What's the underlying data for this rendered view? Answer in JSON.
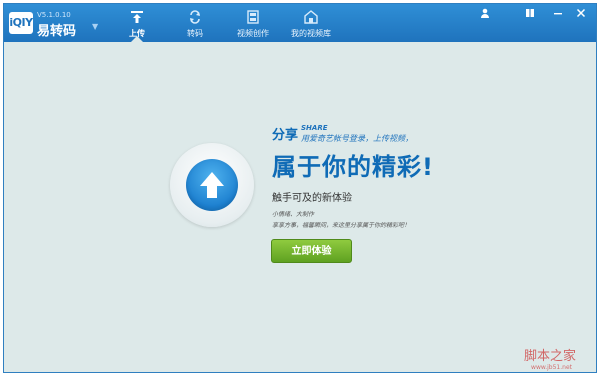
{
  "app": {
    "logo_text": "iQIY",
    "version": "V5.1.0.10",
    "name": "易转码"
  },
  "tabs": [
    {
      "label": "上传",
      "icon": "upload-tab-icon",
      "active": true
    },
    {
      "label": "转码",
      "icon": "convert-icon",
      "active": false
    },
    {
      "label": "视频创作",
      "icon": "film-icon",
      "active": false
    },
    {
      "label": "我的视频库",
      "icon": "home-icon",
      "active": false
    }
  ],
  "window_controls": {
    "user": "user-icon",
    "skin": "skin-icon",
    "minimize": "minimize-icon",
    "close": "close-icon"
  },
  "hero": {
    "small_title": "分享",
    "share_en": "SHARE",
    "subtitle_small": "用爱奇艺帐号登录，上传视频，",
    "big_title": "属于你的精彩!",
    "tagline": "触手可及的新体验",
    "note1": "小情绪、大制作",
    "note2": "享享方事，福馨瞬间，来这里分享属于你的精彩吧！",
    "cta_label": "立即体验"
  },
  "watermark": {
    "text": "脚本之家",
    "url": "www.jb51.net"
  },
  "colors": {
    "titlebar": "#1f73bd",
    "background": "#dde9e9",
    "accent": "#0f6bb6",
    "cta": "#6aaa27"
  }
}
